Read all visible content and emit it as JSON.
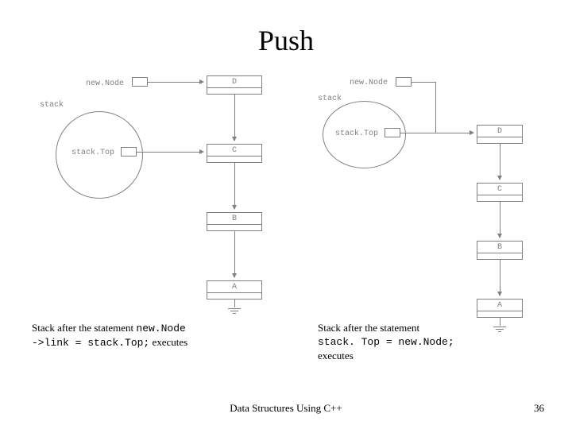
{
  "title": "Push",
  "diagrams": {
    "newNode": "new.Node",
    "stack": "stack",
    "stackTop": "stack.Top",
    "nodes": {
      "d": "D",
      "c": "C",
      "b": "B",
      "a": "A"
    }
  },
  "captions": {
    "left_prefix": "Stack after the statement  ",
    "left_code1": "new.Node",
    "left_code2": "->link = stack.Top;",
    "left_suffix": " executes",
    "right_prefix": "Stack after the statement ",
    "right_code": "stack. Top = new.Node;",
    "right_suffix": " executes"
  },
  "footer": {
    "center": "Data Structures Using C++",
    "page": "36"
  }
}
